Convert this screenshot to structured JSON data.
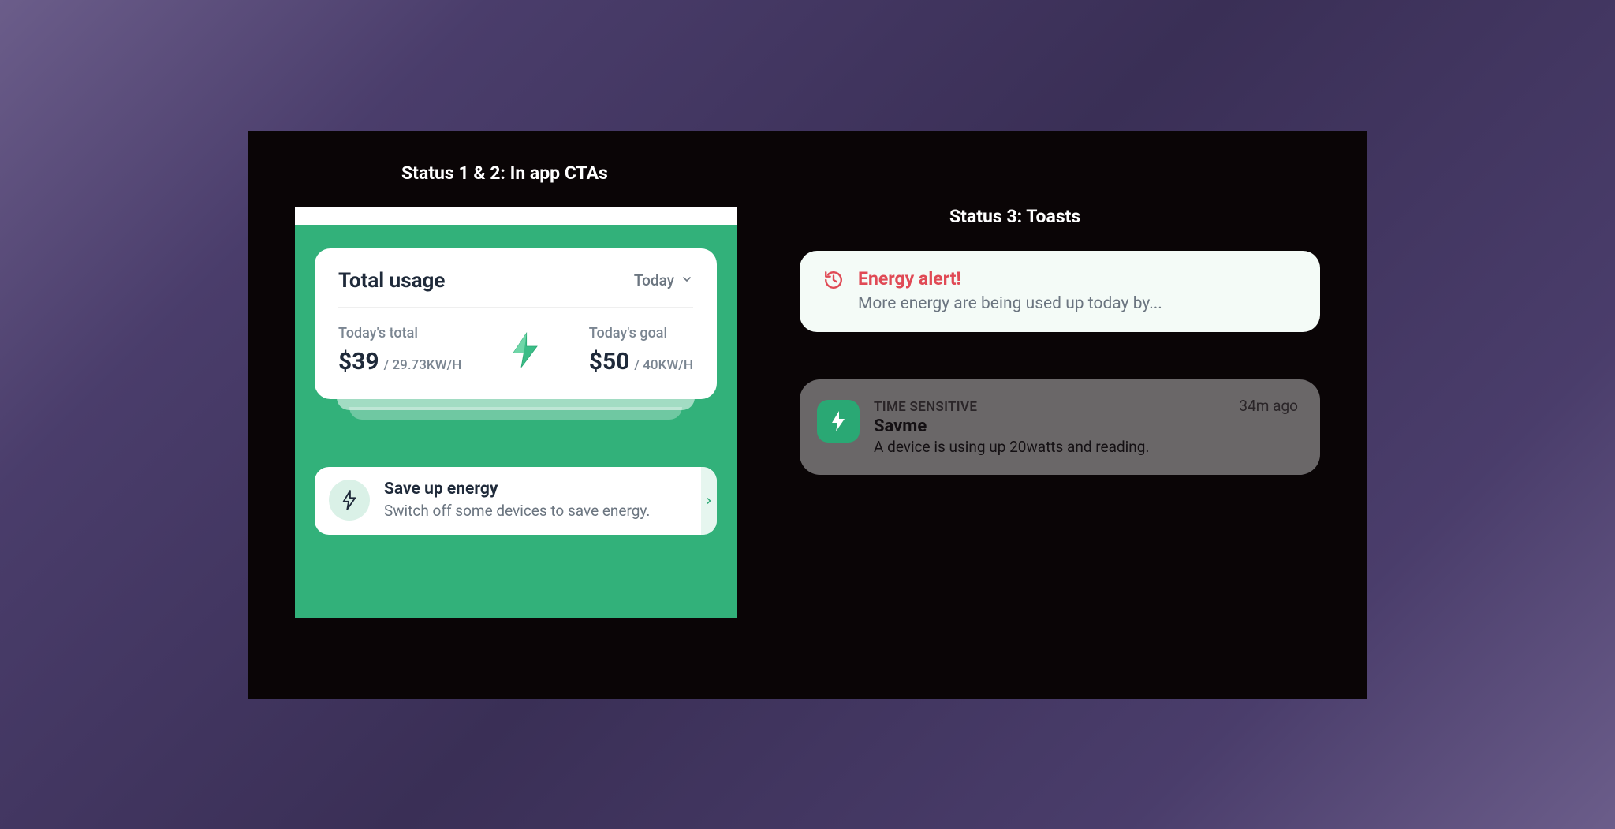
{
  "sections": {
    "left_title": "Status 1 & 2: In app CTAs",
    "right_title": "Status 3: Toasts"
  },
  "usage_card": {
    "title": "Total usage",
    "period_label": "Today",
    "today_total_label": "Today's total",
    "today_total_amount": "$39",
    "today_total_unit": "/ 29.73KW/H",
    "today_goal_label": "Today's goal",
    "today_goal_amount": "$50",
    "today_goal_unit": "/ 40KW/H"
  },
  "save_card": {
    "title": "Save up energy",
    "subtitle": "Switch off some devices to save energy."
  },
  "toast_alert": {
    "title": "Energy alert!",
    "body": "More energy are being used up today by..."
  },
  "toast_notif": {
    "tag": "TIME SENSITIVE",
    "time_ago": "34m ago",
    "app_name": "Savme",
    "message": "A device is using up 20watts and reading."
  },
  "colors": {
    "accent": "#2aa874",
    "alert": "#e04a55"
  }
}
